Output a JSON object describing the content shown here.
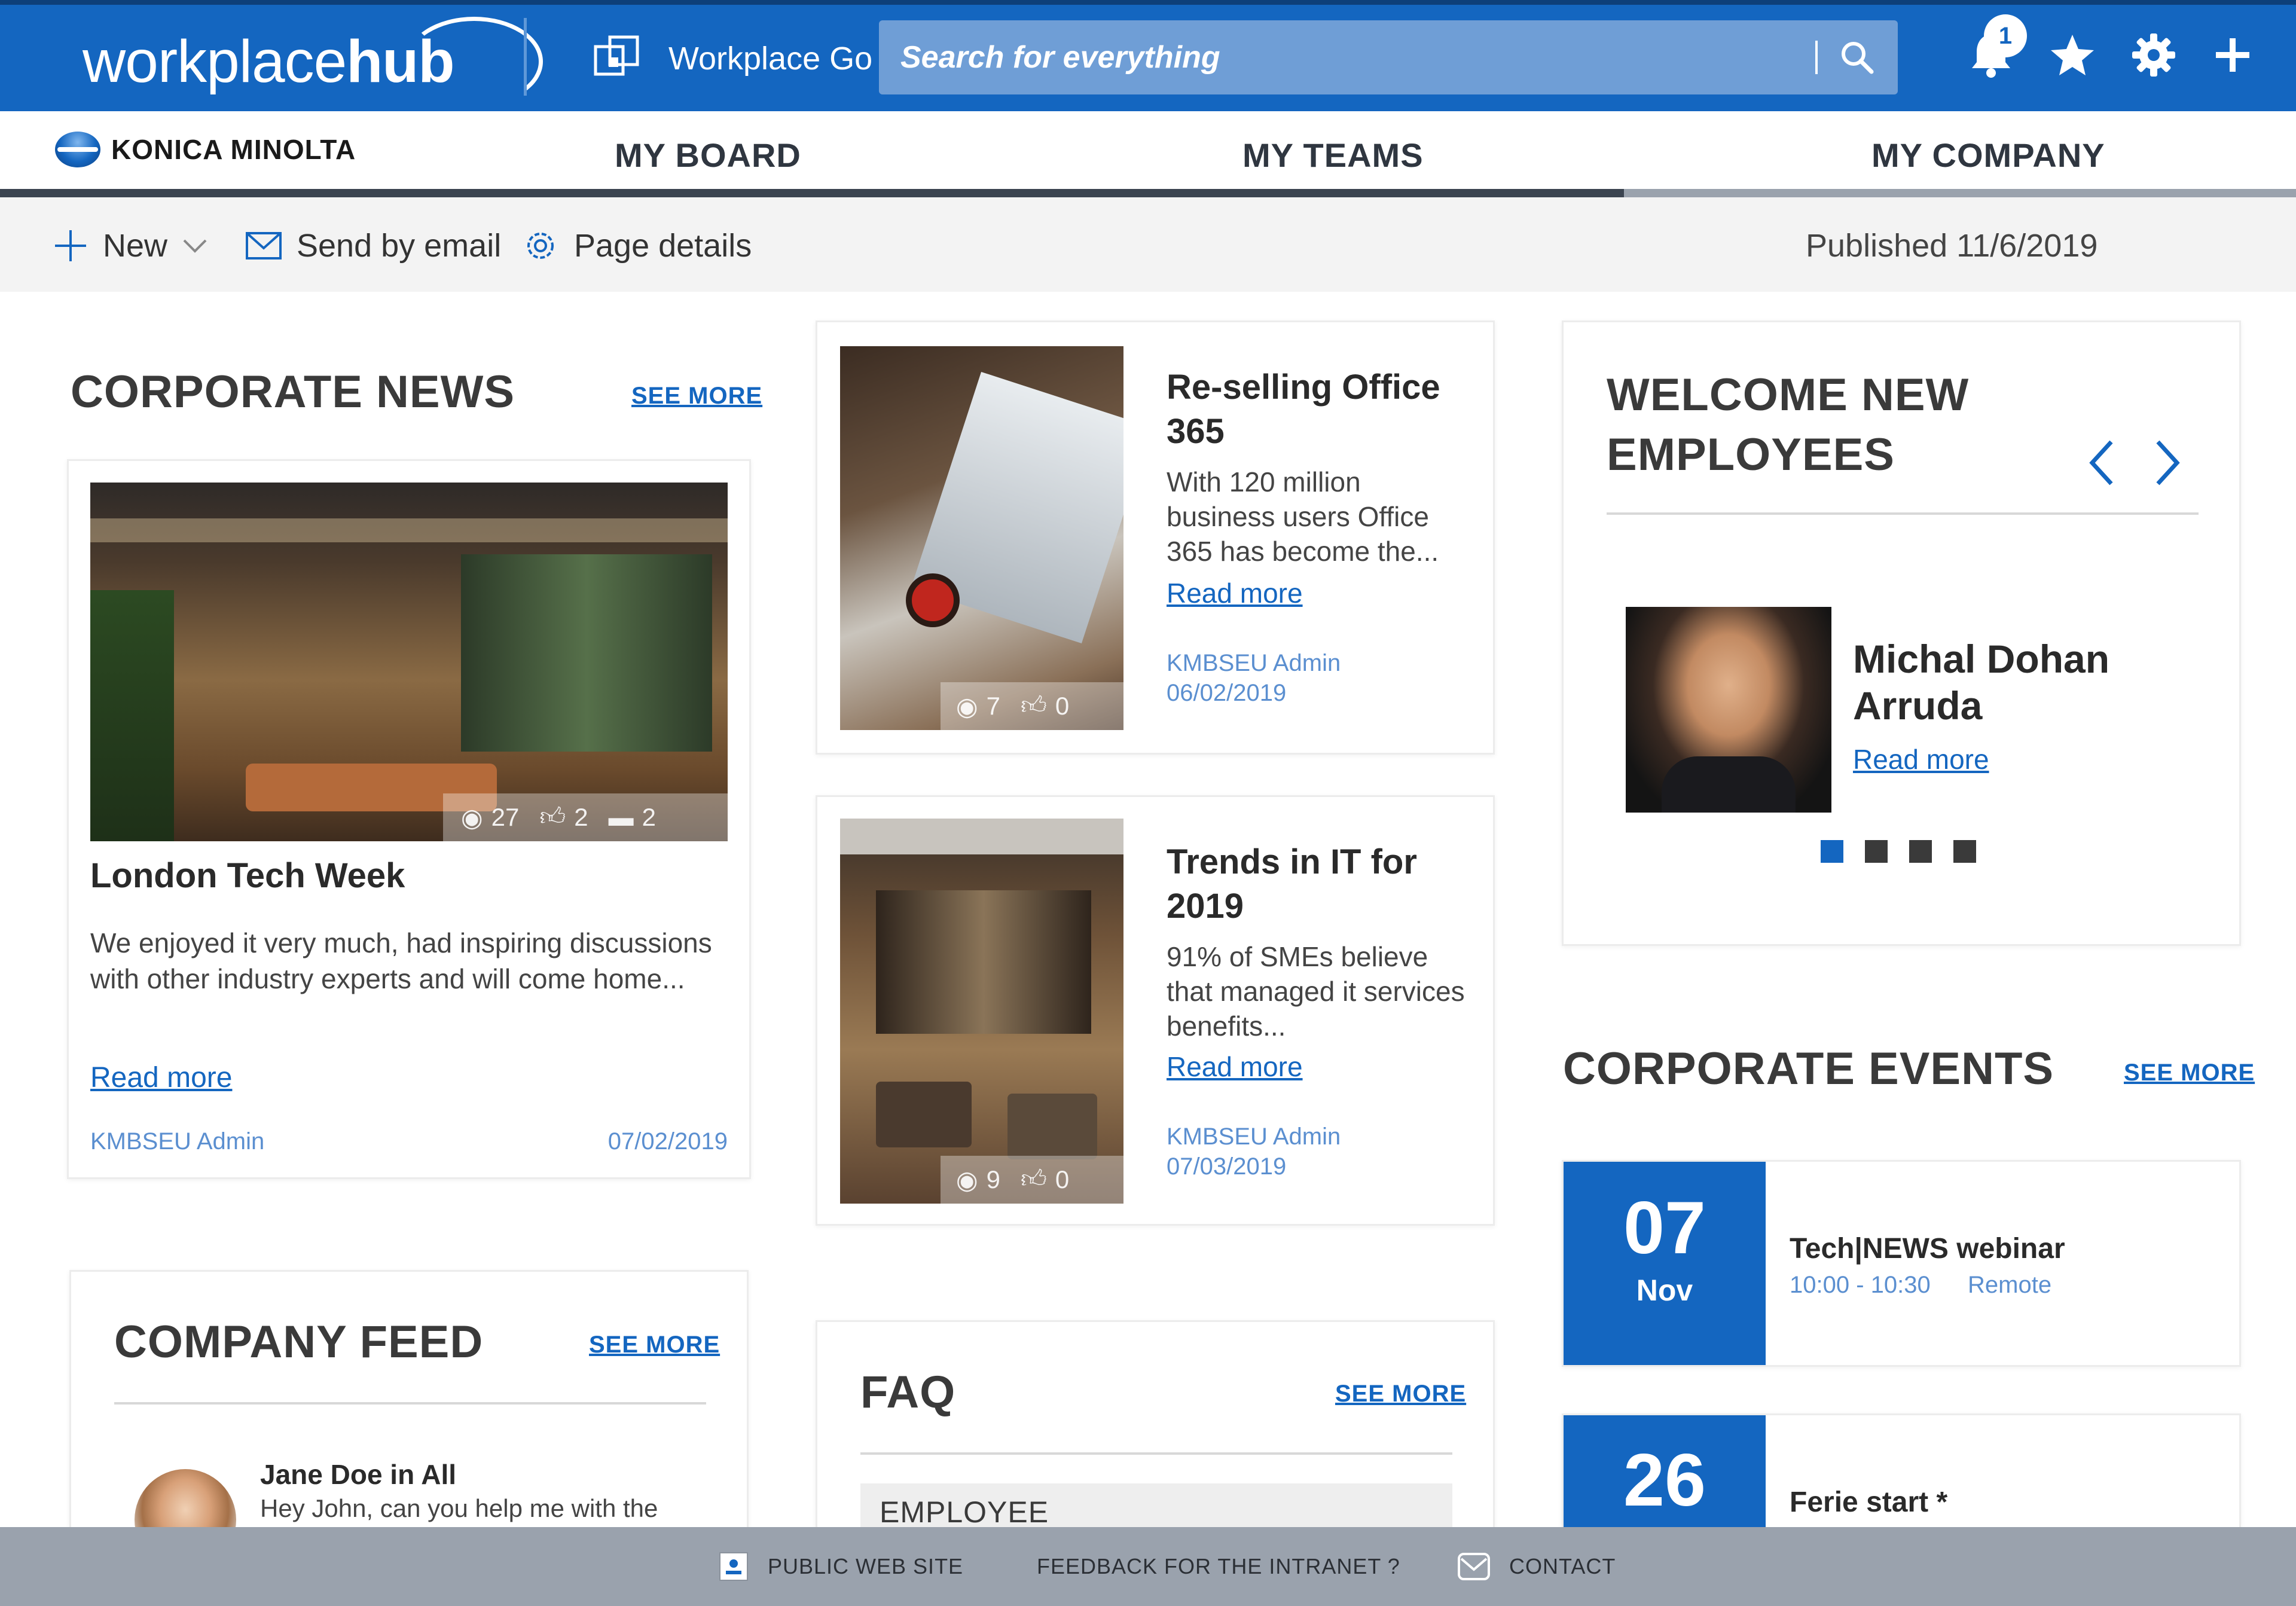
{
  "topbar": {
    "logo_light": "workplace",
    "logo_bold": "hub",
    "workplace_go": "Workplace Go",
    "search_placeholder": "Search for everything",
    "notification_count": "1",
    "icons": [
      "bell-icon",
      "star-icon",
      "gear-icon",
      "plus-icon"
    ]
  },
  "nav": {
    "brand": "KONICA MINOLTA",
    "tabs": [
      "MY BOARD",
      "MY TEAMS",
      "MY COMPANY"
    ]
  },
  "command_bar": {
    "new": "New",
    "send_email": "Send by email",
    "page_details": "Page details",
    "published": "Published 11/6/2019"
  },
  "corporate_news": {
    "title": "CORPORATE NEWS",
    "see_more": "SEE MORE",
    "featured": {
      "views": "27",
      "likes": "2",
      "comments": "2",
      "headline": "London Tech Week",
      "excerpt": "We enjoyed it very much, had inspiring discussions with other industry experts and will come home...",
      "read_more": "Read more",
      "author": "KMBSEU Admin",
      "date": "07/02/2019"
    }
  },
  "news_cards": [
    {
      "headline": "Re-selling Office 365",
      "excerpt": "With 120 million business users Office 365 has become the...",
      "read_more": "Read more",
      "author": "KMBSEU Admin",
      "date": "06/02/2019",
      "views": "7",
      "likes": "0"
    },
    {
      "headline": "Trends in IT for 2019",
      "excerpt": "91% of SMEs believe that managed it services benefits...",
      "read_more": "Read more",
      "author": "KMBSEU Admin",
      "date": "07/03/2019",
      "views": "9",
      "likes": "0"
    }
  ],
  "welcome": {
    "title_line1": "WELCOME NEW",
    "title_line2": "EMPLOYEES",
    "employee_first": "Michal Dohan",
    "employee_last": "Arruda",
    "read_more": "Read more",
    "dots_total": 4,
    "dots_active": 1
  },
  "events": {
    "title": "CORPORATE EVENTS",
    "see_more": "SEE MORE",
    "items": [
      {
        "day": "07",
        "month": "Nov",
        "name": "Tech|NEWS webinar",
        "time": "10:00 - 10:30",
        "location": "Remote"
      },
      {
        "day": "26",
        "month": "",
        "name": "Ferie start *",
        "time": "",
        "location": ""
      }
    ]
  },
  "company_feed": {
    "title": "COMPANY FEED",
    "see_more": "SEE MORE",
    "post_author": "Jane Doe in All",
    "post_text": "Hey John, can you help me with the"
  },
  "faq": {
    "title": "FAQ",
    "see_more": "SEE MORE",
    "first_category": "EMPLOYEE"
  },
  "footer": {
    "public_site": "PUBLIC WEB SITE",
    "feedback": "FEEDBACK FOR THE INTRANET ?",
    "contact": "CONTACT"
  },
  "colors": {
    "brand_blue": "#1466c0",
    "top_border": "#0d3f7a",
    "footer_gray": "#9aa2ad"
  }
}
